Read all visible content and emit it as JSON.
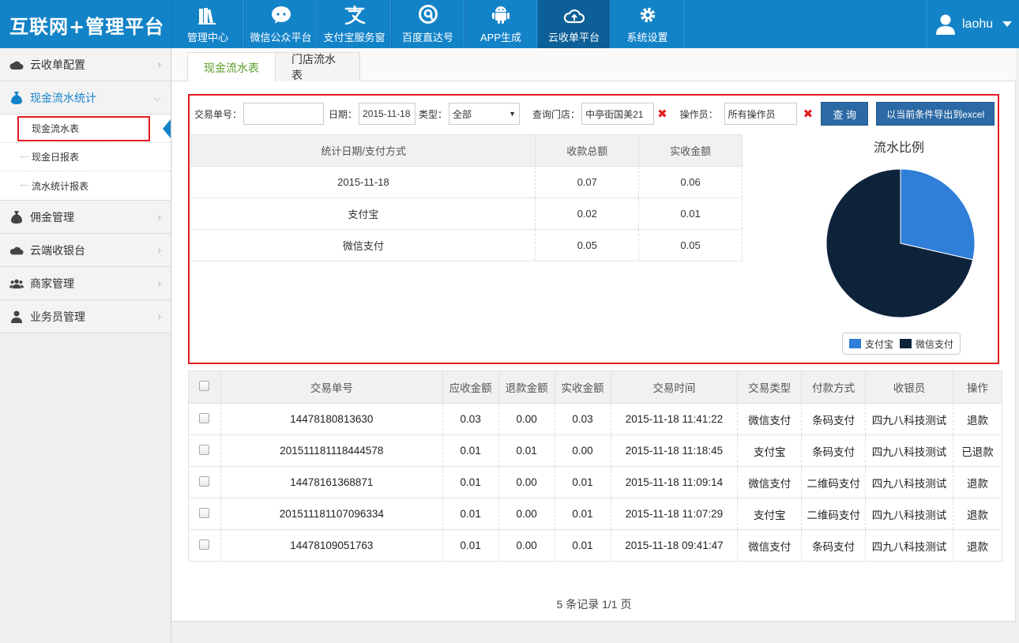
{
  "app": {
    "brand": "互联网+管理平台"
  },
  "nav": [
    {
      "label": "管理中心",
      "icon": "books-icon"
    },
    {
      "label": "微信公众平台",
      "icon": "wechat-icon"
    },
    {
      "label": "支付宝服务窗",
      "icon": "alipay-icon"
    },
    {
      "label": "百度直达号",
      "icon": "baidu-icon"
    },
    {
      "label": "APP生成",
      "icon": "android-icon"
    },
    {
      "label": "云收单平台",
      "icon": "cloud-upload-icon",
      "active": true
    },
    {
      "label": "系统设置",
      "icon": "gear-icon"
    }
  ],
  "user": {
    "name": "laohu"
  },
  "sidebar": {
    "items": [
      {
        "label": "云收单配置",
        "icon": "cloud-icon"
      },
      {
        "label": "现金流水统计",
        "icon": "money-bag-icon",
        "open": true
      },
      {
        "label": "佣金管理",
        "icon": "money-bag-icon"
      },
      {
        "label": "云端收银台",
        "icon": "cloud-money-icon"
      },
      {
        "label": "商家管理",
        "icon": "users-icon"
      },
      {
        "label": "业务员管理",
        "icon": "user-icon"
      }
    ],
    "subitems": [
      "现金流水表",
      "现金日报表",
      "流水统计报表"
    ]
  },
  "tabs": [
    "现金流水表",
    "门店流水表"
  ],
  "filters": {
    "order_no_label": "交易单号：",
    "order_no_value": "",
    "date_label": "日期：",
    "date_value": "2015-11-18",
    "type_label": "类型：",
    "type_value": "全部",
    "store_label": "查询门店：",
    "store_value": "中亭街国美21",
    "operator_label": "操作员：",
    "operator_value": "所有操作员",
    "query_button": "查 询",
    "export_button": "以当前条件导出到excel"
  },
  "summary": {
    "headers": [
      "统计日期/支付方式",
      "收款总额",
      "实收金额"
    ],
    "rows": [
      [
        "2015-11-18",
        "0.07",
        "0.06"
      ],
      [
        "支付宝",
        "0.02",
        "0.01"
      ],
      [
        "微信支付",
        "0.05",
        "0.05"
      ]
    ]
  },
  "chart_data": {
    "type": "pie",
    "title": "流水比例",
    "categories": [
      "支付宝",
      "微信支付"
    ],
    "values": [
      0.02,
      0.05
    ],
    "colors": [
      "#2f7ed8",
      "#0d233a"
    ],
    "legend": "bottom"
  },
  "table": {
    "headers": [
      "交易单号",
      "应收金额",
      "退款金额",
      "实收金额",
      "交易时间",
      "交易类型",
      "付款方式",
      "收银员",
      "操作"
    ],
    "rows": [
      [
        "14478180813630",
        "0.03",
        "0.00",
        "0.03",
        "2015-11-18 11:41:22",
        "微信支付",
        "条码支付",
        "四九八科技测试",
        "退款"
      ],
      [
        "201511181118444578",
        "0.01",
        "0.01",
        "0.00",
        "2015-11-18 11:18:45",
        "支付宝",
        "条码支付",
        "四九八科技测试",
        "已退款"
      ],
      [
        "14478161368871",
        "0.01",
        "0.00",
        "0.01",
        "2015-11-18 11:09:14",
        "微信支付",
        "二维码支付",
        "四九八科技测试",
        "退款"
      ],
      [
        "201511181107096334",
        "0.01",
        "0.00",
        "0.01",
        "2015-11-18 11:07:29",
        "支付宝",
        "二维码支付",
        "四九八科技测试",
        "退款"
      ],
      [
        "14478109051763",
        "0.01",
        "0.00",
        "0.01",
        "2015-11-18 09:41:47",
        "微信支付",
        "条码支付",
        "四九八科技测试",
        "退款"
      ]
    ]
  },
  "pager": "5 条记录 1/1 页"
}
